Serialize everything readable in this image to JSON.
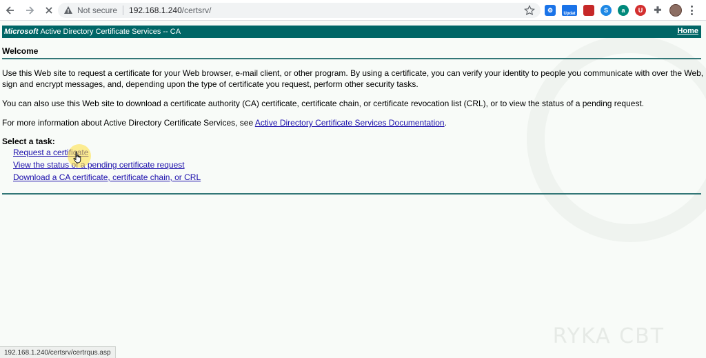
{
  "browser": {
    "security_label": "Not secure",
    "url_host": "192.168.1.240",
    "url_path": "/certsrv/",
    "extension_badge": "Updat"
  },
  "header": {
    "brand": "Microsoft",
    "title": "Active Directory Certificate Services  --  CA",
    "home_link": "Home",
    "bar_color": "#006666"
  },
  "page": {
    "heading": "Welcome",
    "para1": "Use this Web site to request a certificate for your Web browser, e-mail client, or other program. By using a certificate, you can verify your identity to people you communicate with over the Web, sign and encrypt messages, and, depending upon the type of certificate you request, perform other security tasks.",
    "para2": "You can also use this Web site to download a certificate authority (CA) certificate, certificate chain, or certificate revocation list (CRL), or to view the status of a pending request.",
    "para3_prefix": "For more information about Active Directory Certificate Services, see ",
    "para3_link": "Active Directory Certificate Services Documentation",
    "para3_suffix": ".",
    "select_task_label": "Select a task:",
    "tasks": [
      "Request a certificate",
      "View the status of a pending certificate request",
      "Download a CA certificate, certificate chain, or CRL"
    ]
  },
  "status_bar": {
    "url": "192.168.1.240/certsrv/certrqus.asp"
  },
  "watermark": {
    "brand": "RYKA CBT"
  }
}
